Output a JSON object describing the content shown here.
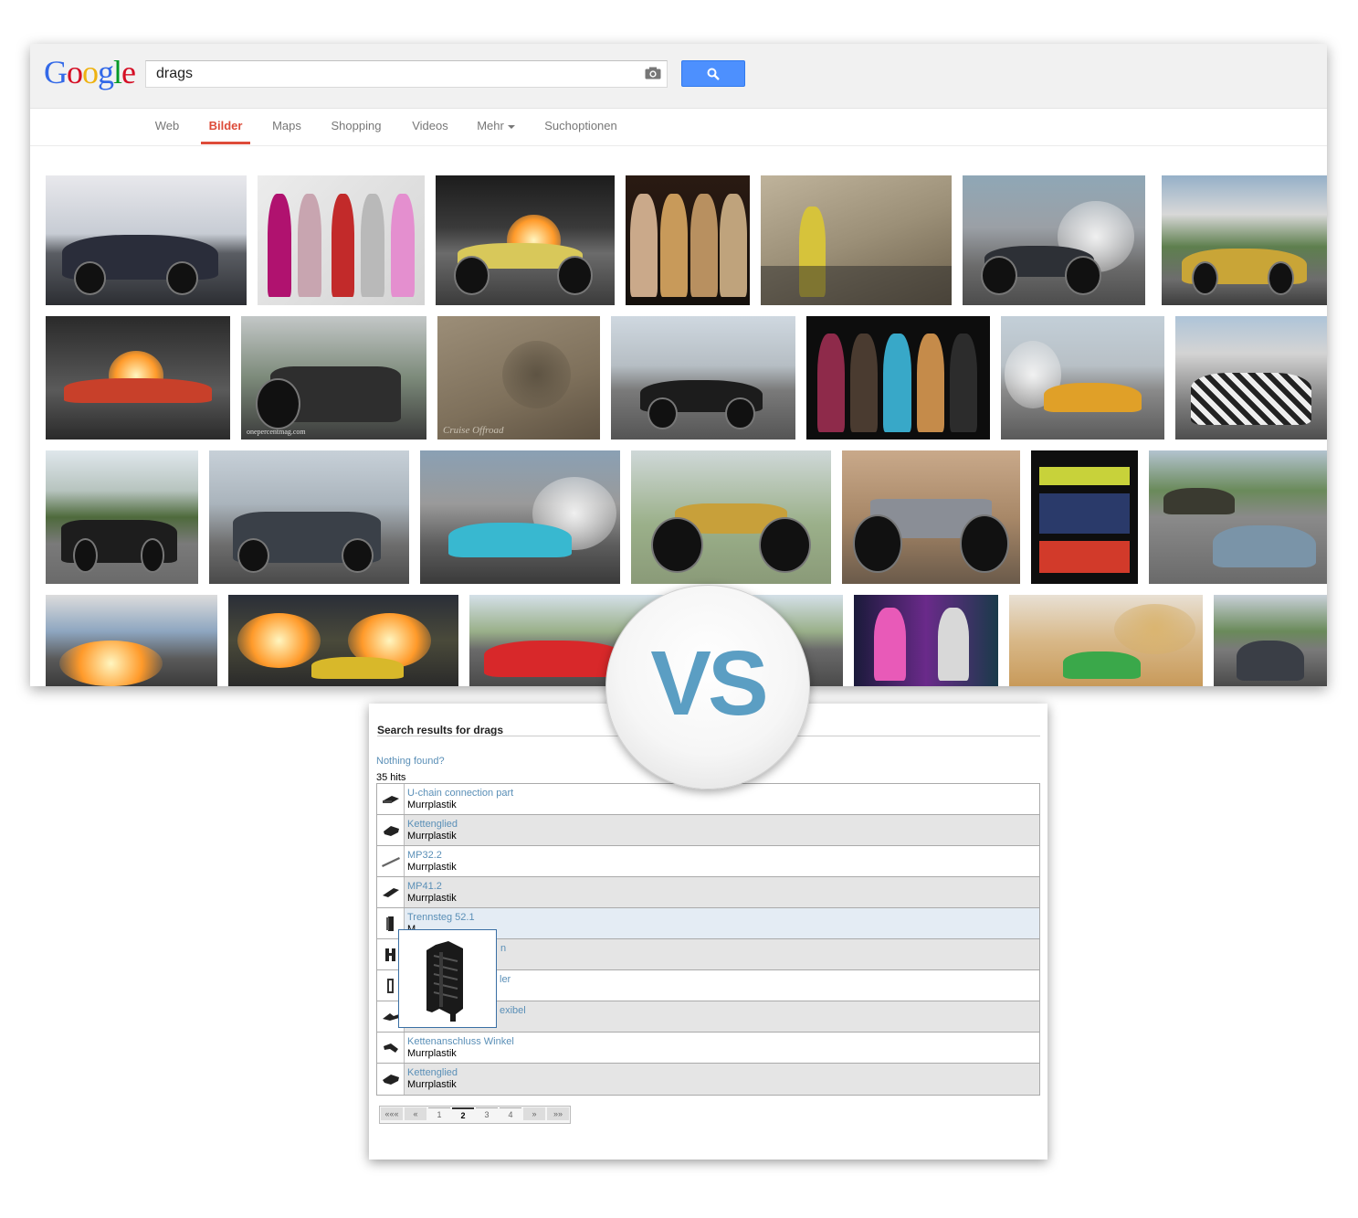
{
  "google": {
    "logo": "Google",
    "search_value": "drags",
    "tabs": [
      {
        "label": "Web"
      },
      {
        "label": "Bilder",
        "active": true
      },
      {
        "label": "Maps"
      },
      {
        "label": "Shopping"
      },
      {
        "label": "Videos"
      },
      {
        "label": "Mehr"
      },
      {
        "label": "Suchoptionen"
      }
    ],
    "watermarks": [
      "onepercentmag.com",
      "Cruise Offroad"
    ],
    "colors": {
      "active_tab": "#dd4b39",
      "search_button": "#4d90fe"
    }
  },
  "vs_label": "VS",
  "results": {
    "title": "Search results for drags",
    "nothing_found": "Nothing found?",
    "hits": "35 hits",
    "items": [
      {
        "name": "U-chain connection part",
        "maker": "Murrplastik"
      },
      {
        "name": "Kettenglied",
        "maker": "Murrplastik"
      },
      {
        "name": "MP32.2",
        "maker": "Murrplastik"
      },
      {
        "name": "MP41.2",
        "maker": "Murrplastik"
      },
      {
        "name": "Trennsteg 52.1",
        "maker": "M"
      },
      {
        "name": "n",
        "maker": ""
      },
      {
        "name": "ler",
        "maker": ""
      },
      {
        "name": "exibel",
        "maker": ""
      },
      {
        "name": "Kettenanschluss Winkel",
        "maker": "Murrplastik"
      },
      {
        "name": "Kettenglied",
        "maker": "Murrplastik"
      }
    ],
    "pager": [
      "«««",
      "«",
      "1",
      "2",
      "3",
      "4",
      "»",
      "»»"
    ],
    "current_page": "2"
  }
}
